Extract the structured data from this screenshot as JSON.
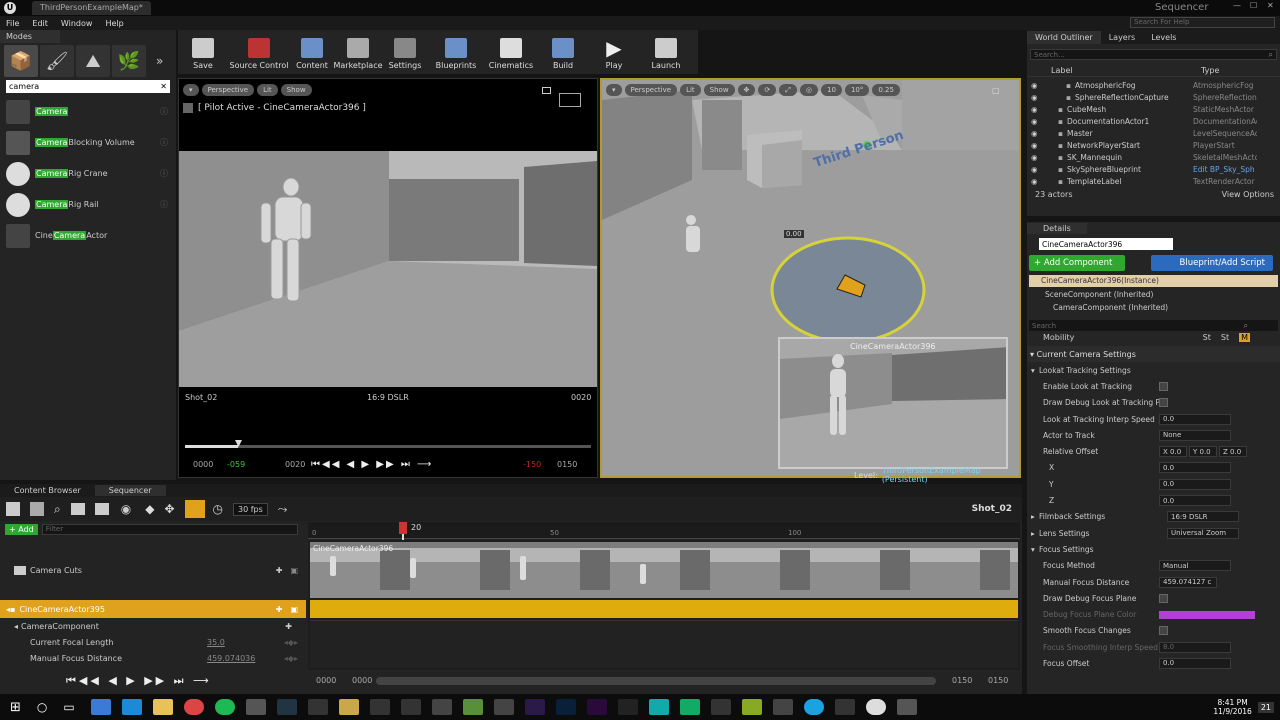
{
  "window": {
    "tab_title": "ThirdPersonExampleMap*",
    "app_name": "Sequencer",
    "help_search_placeholder": "Search For Help"
  },
  "menu": [
    "File",
    "Edit",
    "Window",
    "Help"
  ],
  "modes": {
    "tab_label": "Modes",
    "search_value": "camera",
    "items": [
      {
        "highlight": "Camera",
        "rest": ""
      },
      {
        "highlight": "Camera",
        "rest": " Blocking Volume"
      },
      {
        "highlight": "Camera",
        "rest": " Rig Crane"
      },
      {
        "highlight": "Camera",
        "rest": " Rig Rail"
      },
      {
        "prefix": "Cine ",
        "highlight": "Camera",
        "rest": " Actor"
      }
    ]
  },
  "toolbar": {
    "buttons": [
      "Save",
      "Source Control",
      "Content",
      "Marketplace",
      "Settings",
      "Blueprints",
      "Cinematics",
      "Build",
      "Play",
      "Launch"
    ]
  },
  "viewport_left": {
    "perspective": "Perspective",
    "lit": "Lit",
    "show": "Show",
    "pilot_label": "[ Pilot Active - CineCameraActor396 ]",
    "shot": "Shot_02",
    "filmback": "16:9 DSLR",
    "frame": "0020",
    "time_start": "0000",
    "time_neg": "-059",
    "time_cur": "0020",
    "time_red": "-150",
    "time_end": "0150"
  },
  "viewport_right": {
    "perspective": "Perspective",
    "lit": "Lit",
    "show": "Show",
    "grid": "10",
    "angle": "10°",
    "scale": "0.25",
    "marker_value": "0.00",
    "preview_title": "CineCameraActor396",
    "level_prefix": "Level:",
    "level_name": "ThirdPersonExampleMap (Persistent)",
    "floor_text": "Third Person"
  },
  "outliner": {
    "tabs": [
      "World Outliner",
      "Layers",
      "Levels"
    ],
    "search_placeholder": "Search...",
    "col_label": "Label",
    "col_type": "Type",
    "rows": [
      {
        "label": "AtmosphericFog",
        "type": "AtmosphericFog",
        "indent": true
      },
      {
        "label": "SphereReflectionCapture",
        "type": "SphereReflectionC",
        "indent": true
      },
      {
        "label": "CubeMesh",
        "type": "StaticMeshActor",
        "indent": false
      },
      {
        "label": "DocumentationActor1",
        "type": "DocumentationAct",
        "indent": false
      },
      {
        "label": "Master",
        "type": "LevelSequenceAct",
        "indent": false
      },
      {
        "label": "NetworkPlayerStart",
        "type": "PlayerStart",
        "indent": false
      },
      {
        "label": "SK_Mannequin",
        "type": "SkeletalMeshActo",
        "indent": false
      },
      {
        "label": "SkySphereBlueprint",
        "type": "Edit BP_Sky_Sph",
        "indent": false
      },
      {
        "label": "TemplateLabel",
        "type": "TextRenderActor",
        "indent": false
      }
    ],
    "actor_count": "23 actors",
    "view_options": "View Options"
  },
  "details": {
    "tab": "Details",
    "name_value": "CineCameraActor396",
    "add_component": "+ Add Component",
    "blueprint_script": "Blueprint/Add Script",
    "instance_label": "CineCameraActor396(Instance)",
    "components": [
      "SceneComponent (Inherited)",
      "CameraComponent (Inherited)"
    ],
    "search_placeholder": "Search",
    "mobility": "Mobility",
    "mobility_opts": [
      "St",
      "St",
      "M"
    ],
    "section": "Current Camera Settings",
    "rows": [
      {
        "label": "Lookat Tracking Settings",
        "kind": "group"
      },
      {
        "label": "Enable Look at Tracking",
        "kind": "check"
      },
      {
        "label": "Draw Debug Look at Tracking P",
        "kind": "check"
      },
      {
        "label": "Look at Tracking Interp Speed",
        "kind": "value",
        "value": "0.0"
      },
      {
        "label": "Actor to Track",
        "kind": "dropdown",
        "value": "None"
      },
      {
        "label": "Relative Offset",
        "kind": "xyz",
        "values": [
          "X 0.0",
          "Y 0.0",
          "Z 0.0"
        ]
      },
      {
        "label": "X",
        "kind": "value",
        "value": "0.0",
        "sub": true
      },
      {
        "label": "Y",
        "kind": "value",
        "value": "0.0",
        "sub": true
      },
      {
        "label": "Z",
        "kind": "value",
        "value": "0.0",
        "sub": true
      },
      {
        "label": "Filmback Settings",
        "kind": "dropdown",
        "value": "16:9 DSLR",
        "group": true
      },
      {
        "label": "Lens Settings",
        "kind": "dropdown",
        "value": "Universal Zoom",
        "group": true
      },
      {
        "label": "Focus Settings",
        "kind": "group"
      },
      {
        "label": "Focus Method",
        "kind": "dropdown",
        "value": "Manual"
      },
      {
        "label": "Manual Focus Distance",
        "kind": "value",
        "value": "459.074127 c"
      },
      {
        "label": "Draw Debug Focus Plane",
        "kind": "check"
      },
      {
        "label": "Debug Focus Plane Color",
        "kind": "color",
        "dim": true
      },
      {
        "label": "Smooth Focus Changes",
        "kind": "check"
      },
      {
        "label": "Focus Smoothing Interp Speed",
        "kind": "value",
        "value": "8.0",
        "dim": true
      },
      {
        "label": "Focus Offset",
        "kind": "value",
        "value": "0.0"
      }
    ]
  },
  "sequencer": {
    "tabs": [
      "Content Browser",
      "Sequencer"
    ],
    "fps": "30 fps",
    "shot_name": "Shot_02",
    "add_label": "+ Add",
    "filter_placeholder": "Filter",
    "ruler": [
      "0",
      "20",
      "50",
      "100"
    ],
    "tracks": [
      {
        "label": "Camera Cuts",
        "kind": "cuts"
      },
      {
        "label": "CineCameraActor395",
        "kind": "actor"
      },
      {
        "label": "CameraComponent",
        "kind": "component"
      },
      {
        "label": "Current Focal Length",
        "kind": "prop",
        "value": "35.0"
      },
      {
        "label": "Manual Focus Distance",
        "kind": "prop",
        "value": "459.074036"
      }
    ],
    "cut_label": "CineCameraActor396",
    "range_start_a": "0000",
    "range_start_b": "0000",
    "range_end_a": "0150",
    "range_end_b": "0150"
  },
  "taskbar": {
    "time": "8:41 PM",
    "date": "11/9/2016",
    "notif_count": "21"
  }
}
